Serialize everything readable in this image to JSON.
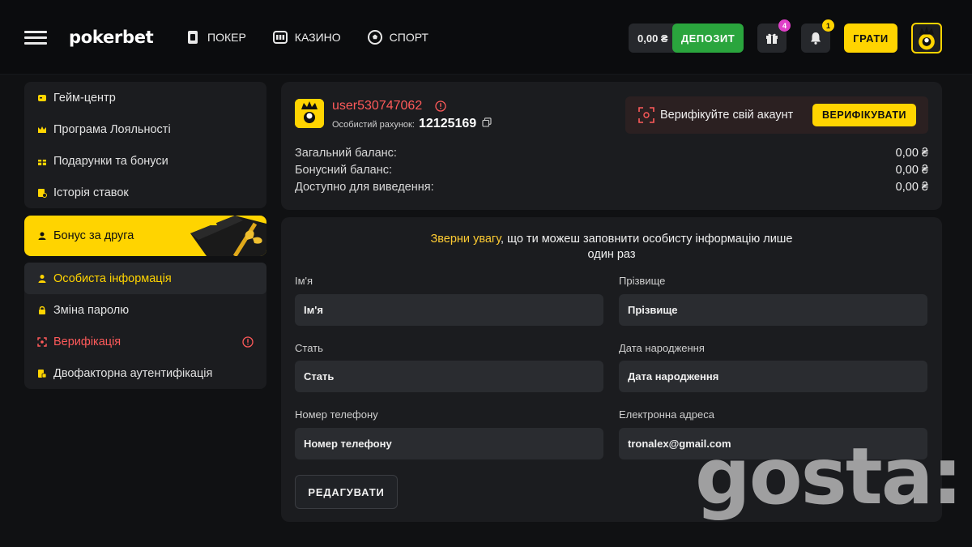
{
  "header": {
    "logo": "pokerbet",
    "nav": [
      {
        "label": "ПОКЕР",
        "icon": "poker-card-icon"
      },
      {
        "label": "КАЗИНО",
        "icon": "slot-machine-icon"
      },
      {
        "label": "СПОРТ",
        "icon": "soccer-ball-icon"
      }
    ],
    "balance": "0,00 ₴",
    "deposit_label": "ДЕПОЗИТ",
    "gift_badge": "4",
    "bell_badge": "1",
    "play_label": "ГРАТИ"
  },
  "sidebar": {
    "group1": [
      {
        "label": "Гейм-центр",
        "icon": "game-center-icon"
      },
      {
        "label": "Програма Лояльності",
        "icon": "crown-icon"
      },
      {
        "label": "Подарунки та бонуси",
        "icon": "gift-icon"
      },
      {
        "label": "Історія ставок",
        "icon": "history-icon"
      }
    ],
    "bonus_banner": "Бонус за друга",
    "group2": [
      {
        "label": "Особиста інформація",
        "icon": "user-icon"
      },
      {
        "label": "Зміна паролю",
        "icon": "lock-icon"
      },
      {
        "label": "Верифікація",
        "icon": "verify-scan-icon"
      },
      {
        "label": "Двофакторна аутентифікація",
        "icon": "two-factor-icon"
      }
    ]
  },
  "profile": {
    "username": "user530747062",
    "account_label": "Особистий рахунок:",
    "account_number": "12125169",
    "verify_text": "Верифікуйте свій акаунт",
    "verify_button": "ВЕРИФІКУВАТИ",
    "balances": [
      {
        "label": "Загальний баланс:",
        "value": "0,00 ₴"
      },
      {
        "label": "Бонусний баланс:",
        "value": "0,00 ₴"
      },
      {
        "label": "Доступно для виведення:",
        "value": "0,00 ₴"
      }
    ]
  },
  "form": {
    "notice_highlight": "Зверни увагу",
    "notice_line1": ", що ти можеш заповнити особисту інформацію лише",
    "notice_line2": "один раз",
    "fields": [
      {
        "label": "Ім'я",
        "placeholder": "Ім'я",
        "value": ""
      },
      {
        "label": "Прізвище",
        "placeholder": "Прізвище",
        "value": ""
      },
      {
        "label": "Стать",
        "placeholder": "Стать",
        "value": ""
      },
      {
        "label": "Дата народження",
        "placeholder": "Дата народження",
        "value": ""
      },
      {
        "label": "Номер телефону",
        "placeholder": "Номер телефону",
        "value": ""
      },
      {
        "label": "Електронна адреса",
        "placeholder": "Електронна адреса",
        "value": "tronalex@gmail.com"
      }
    ],
    "edit_button": "РЕДАГУВАТИ"
  },
  "watermark": "gosta:",
  "colors": {
    "accent_yellow": "#ffd400",
    "deposit_green": "#2aa53d",
    "danger_red": "#ff5a5a",
    "card_bg": "#1b1c1f",
    "page_bg": "#101113"
  }
}
